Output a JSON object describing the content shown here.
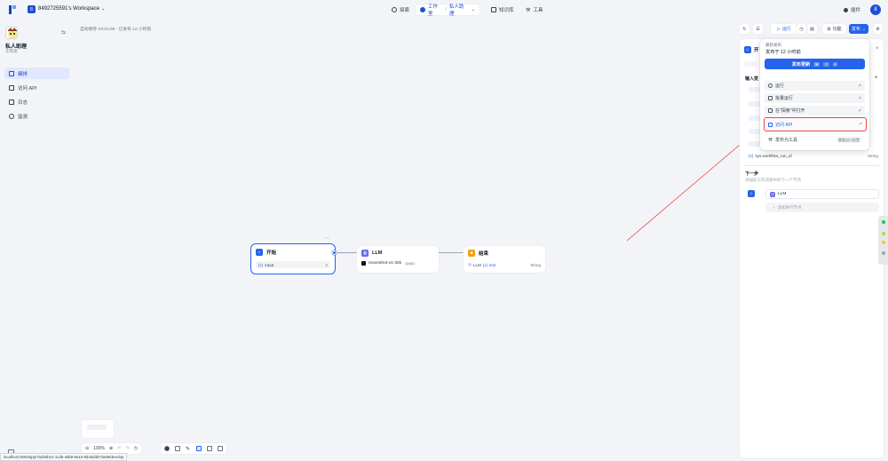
{
  "topbar": {
    "workspace_badge": "8",
    "workspace_name": "8492725591's Workspace",
    "nav": [
      {
        "label": "探索",
        "icon": "compass-icon"
      },
      {
        "label": "工作室",
        "icon": "studio-icon"
      },
      {
        "label": "私人助理",
        "icon": "chevron-down-icon"
      },
      {
        "label": "知识库",
        "icon": "book-icon"
      },
      {
        "label": "工具",
        "icon": "tool-icon"
      }
    ],
    "plugin_label": "插件",
    "avatar_initial": "8"
  },
  "sidebar": {
    "app_name": "私人助理",
    "app_type": "工作流",
    "items": [
      {
        "label": "编排",
        "icon": "layout-icon",
        "active": true
      },
      {
        "label": "访问 API",
        "icon": "api-icon",
        "active": false
      },
      {
        "label": "日志",
        "icon": "log-icon",
        "active": false
      },
      {
        "label": "监测",
        "icon": "monitor-icon",
        "active": false
      }
    ]
  },
  "canvas": {
    "autosave": "自动保存 23:01:09 · 已发布 12 小时前",
    "nodes": {
      "start": {
        "title": "开始",
        "var": "input"
      },
      "llm": {
        "title": "LLM",
        "model": "moonshot-v1-32k",
        "mode": "CHAT"
      },
      "end": {
        "title": "结束",
        "var_source": "LLM",
        "var": "text",
        "var_type": "String"
      }
    },
    "zoom": "100%",
    "status_url": "localhost:3000/app/7a2b5b21-1cd5-4db9-9a10-8d45d3b73a59/develop"
  },
  "actions": {
    "run": "运行",
    "features": "功能",
    "publish": "发布"
  },
  "panel": {
    "title": "开",
    "input_vars_label": "输入变",
    "vars": [
      {
        "name": "sys.workflow_run_id",
        "type": "String"
      }
    ],
    "next_step_title": "下一步",
    "next_step_desc": "添加此工作流程中的下一个节点",
    "next_node": "LLM",
    "add_parallel": "添加并行节点"
  },
  "publish_menu": {
    "latest_label": "最新发布",
    "published_time": "发布于 12 小时前",
    "update_button": "发布更新",
    "shortcut": [
      "⌘",
      "⇧",
      "P"
    ],
    "items": [
      {
        "label": "运行",
        "icon": "play-icon"
      },
      {
        "label": "批量运行",
        "icon": "batch-icon"
      },
      {
        "label": "在\"探索\"中打开",
        "icon": "open-icon"
      },
      {
        "label": "访问 API",
        "icon": "api-icon"
      },
      {
        "label": "发布为工具",
        "icon": "tool-icon",
        "hint": "需要运行配置"
      }
    ]
  },
  "colors": {
    "accent": "#2563eb",
    "highlight": "#ef4444",
    "llm_icon": "#6366f1",
    "end_icon": "#f59e0b"
  }
}
